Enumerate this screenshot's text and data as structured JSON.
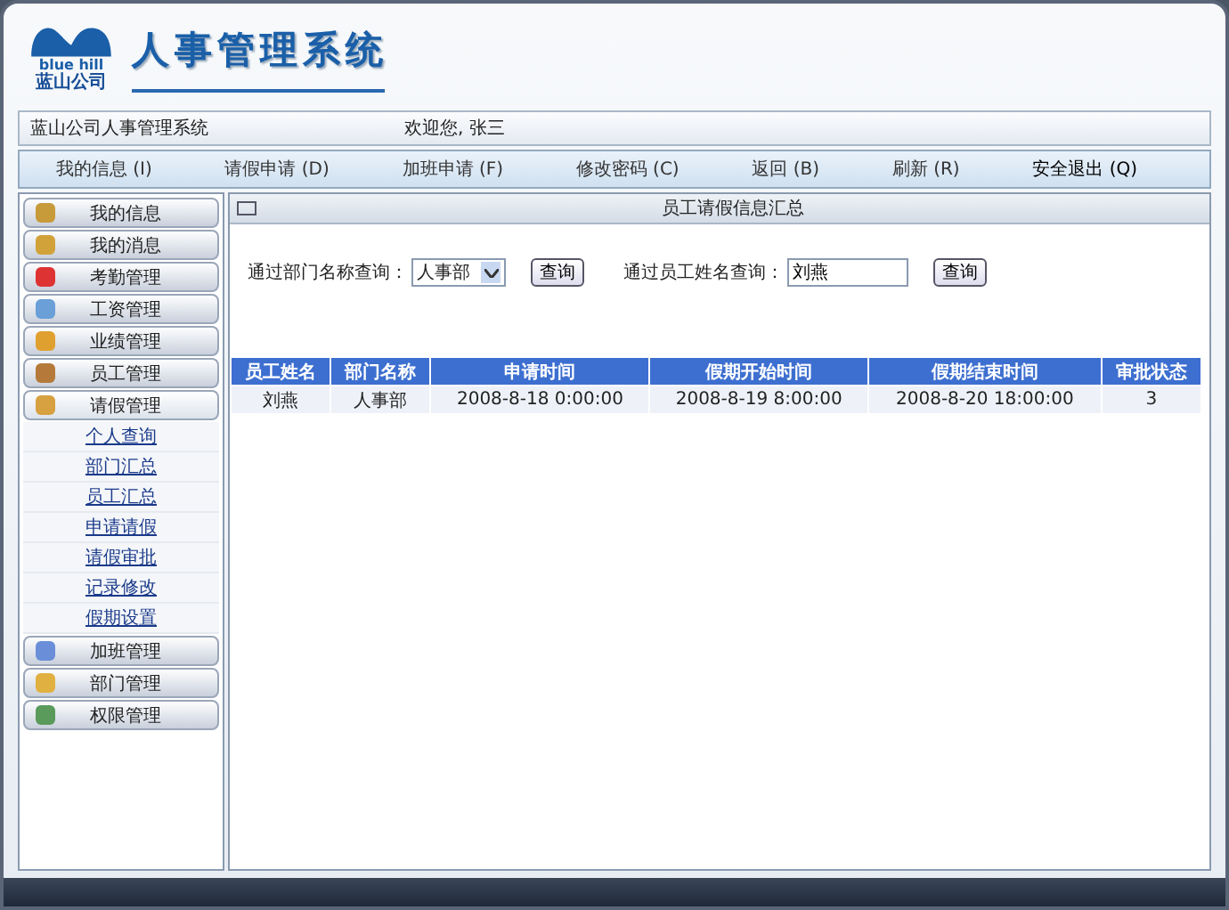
{
  "logo": {
    "brand": "blue hill",
    "company": "蓝山公司"
  },
  "header": {
    "title": "人事管理系统"
  },
  "info_bar": {
    "system": "蓝山公司人事管理系统",
    "welcome": "欢迎您, 张三"
  },
  "nav": [
    "我的信息 (I)",
    "请假申请 (D)",
    "加班申请 (F)",
    "修改密码 (C)",
    "返回 (B)",
    "刷新 (R)",
    "安全退出 (Q)"
  ],
  "sidebar": {
    "items": [
      {
        "label": "我的信息",
        "expanded": false
      },
      {
        "label": "我的消息",
        "expanded": false
      },
      {
        "label": "考勤管理",
        "expanded": false
      },
      {
        "label": "工资管理",
        "expanded": false
      },
      {
        "label": "业绩管理",
        "expanded": false
      },
      {
        "label": "员工管理",
        "expanded": false
      },
      {
        "label": "请假管理",
        "expanded": true,
        "children": [
          {
            "label": "个人查询"
          },
          {
            "label": "部门汇总"
          },
          {
            "label": "员工汇总"
          },
          {
            "label": "申请请假"
          },
          {
            "label": "请假审批"
          },
          {
            "label": "记录修改"
          },
          {
            "label": "假期设置"
          }
        ]
      },
      {
        "label": "加班管理",
        "expanded": false
      },
      {
        "label": "部门管理",
        "expanded": false
      },
      {
        "label": "权限管理",
        "expanded": false
      }
    ]
  },
  "panel": {
    "title": "员工请假信息汇总",
    "dept_query": {
      "label": "通过部门名称查询：",
      "value": "人事部",
      "button": "查询"
    },
    "name_query": {
      "label": "通过员工姓名查询：",
      "value": "刘燕",
      "button": "查询"
    },
    "table": {
      "columns": [
        "员工姓名",
        "部门名称",
        "申请时间",
        "假期开始时间",
        "假期结束时间",
        "审批状态"
      ],
      "rows": [
        [
          "刘燕",
          "人事部",
          "2008-8-18 0:00:00",
          "2008-8-19 8:00:00",
          "2008-8-20 18:00:00",
          "3"
        ]
      ]
    }
  }
}
